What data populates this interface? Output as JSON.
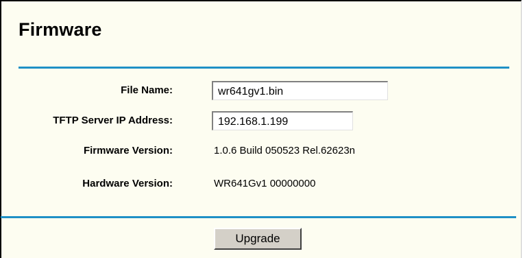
{
  "page": {
    "title": "Firmware"
  },
  "form": {
    "file_name_label": "File Name:",
    "file_name_value": "wr641gv1.bin",
    "tftp_label": "TFTP Server IP Address:",
    "tftp_value": "192.168.1.199",
    "firmware_version_label": "Firmware Version:",
    "firmware_version_value": "1.0.6 Build 050523 Rel.62623n",
    "hardware_version_label": "Hardware Version:",
    "hardware_version_value": "WR641Gv1 00000000"
  },
  "actions": {
    "upgrade_label": "Upgrade"
  },
  "colors": {
    "background": "#fdfdf1",
    "divider": "#1e90c6",
    "button_face": "#d4d0c8"
  }
}
